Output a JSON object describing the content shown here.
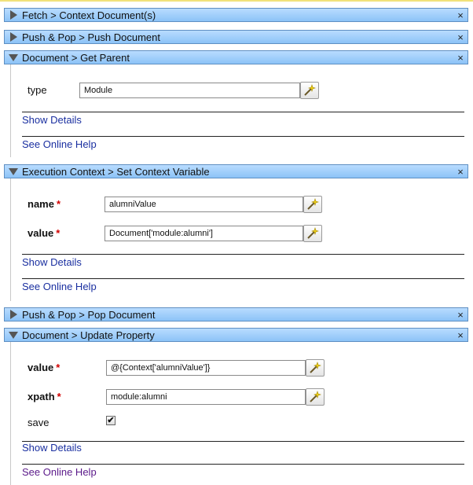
{
  "panels": [
    {
      "title": "Fetch > Context Document(s)",
      "close": "×"
    },
    {
      "title": "Push & Pop > Push Document",
      "close": "×"
    },
    {
      "title": "Document > Get Parent",
      "close": "×",
      "fields": [
        {
          "label": "type",
          "value": "Module"
        }
      ],
      "show_details": "Show Details",
      "online_help": "See Online Help"
    },
    {
      "title": "Execution Context > Set Context Variable",
      "close": "×",
      "fields": [
        {
          "label": "name",
          "required": "*",
          "value": "alumniValue"
        },
        {
          "label": "value",
          "required": "*",
          "value": "Document['module:alumni']"
        }
      ],
      "show_details": "Show Details",
      "online_help": "See Online Help"
    },
    {
      "title": "Push & Pop > Pop Document",
      "close": "×"
    },
    {
      "title": "Document > Update Property",
      "close": "×",
      "fields": [
        {
          "label": "value",
          "required": "*",
          "value": "@{Context['alumniValue']}"
        },
        {
          "label": "xpath",
          "required": "*",
          "value": "module:alumni"
        },
        {
          "label": "save",
          "checked": "✔"
        }
      ],
      "show_details": "Show Details",
      "online_help": "See Online Help"
    }
  ]
}
